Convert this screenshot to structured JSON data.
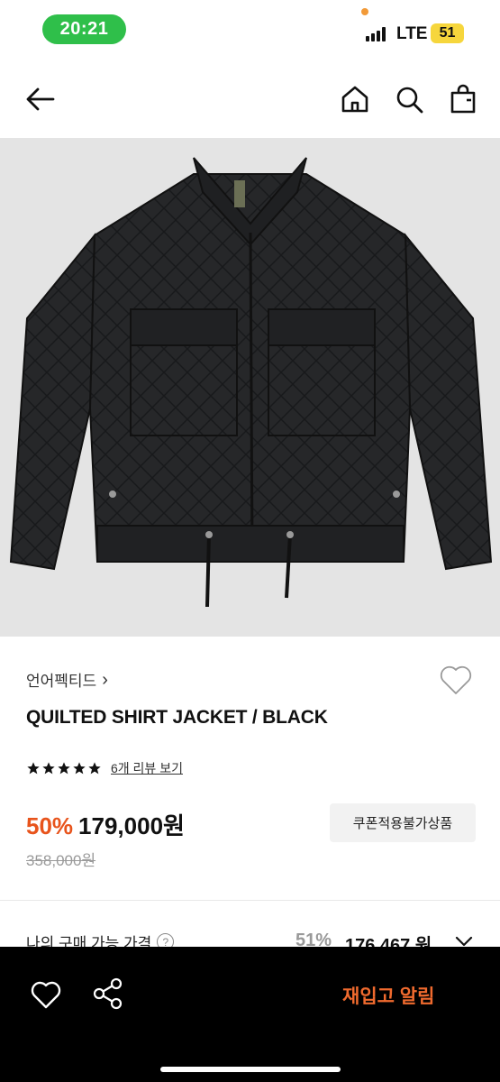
{
  "status": {
    "time": "20:21",
    "network": "LTE",
    "battery": "51"
  },
  "nav": {
    "back_icon": "arrow-left-icon",
    "home_icon": "home-icon",
    "search_icon": "search-icon",
    "bag_icon": "shopping-bag-icon"
  },
  "product": {
    "brand": "언어펙티드",
    "brand_chevron": "›",
    "title": "QUILTED SHIRT JACKET / BLACK",
    "rating_stars": 5,
    "review_link": "6개 리뷰 보기",
    "discount": "50%",
    "price": "179,000원",
    "original_price": "358,000원",
    "coupon_button": "쿠폰적용불가상품"
  },
  "my_price": {
    "label": "나의 구매 가능 가격",
    "help": "?",
    "discount": "51%",
    "price": "176,467 원"
  },
  "bottom_bar": {
    "restock_button": "재입고 알림"
  },
  "colors": {
    "accent": "#e8541c",
    "restock": "#f06a2e",
    "time_pill": "#2fbf4a",
    "battery": "#f6d63c"
  }
}
